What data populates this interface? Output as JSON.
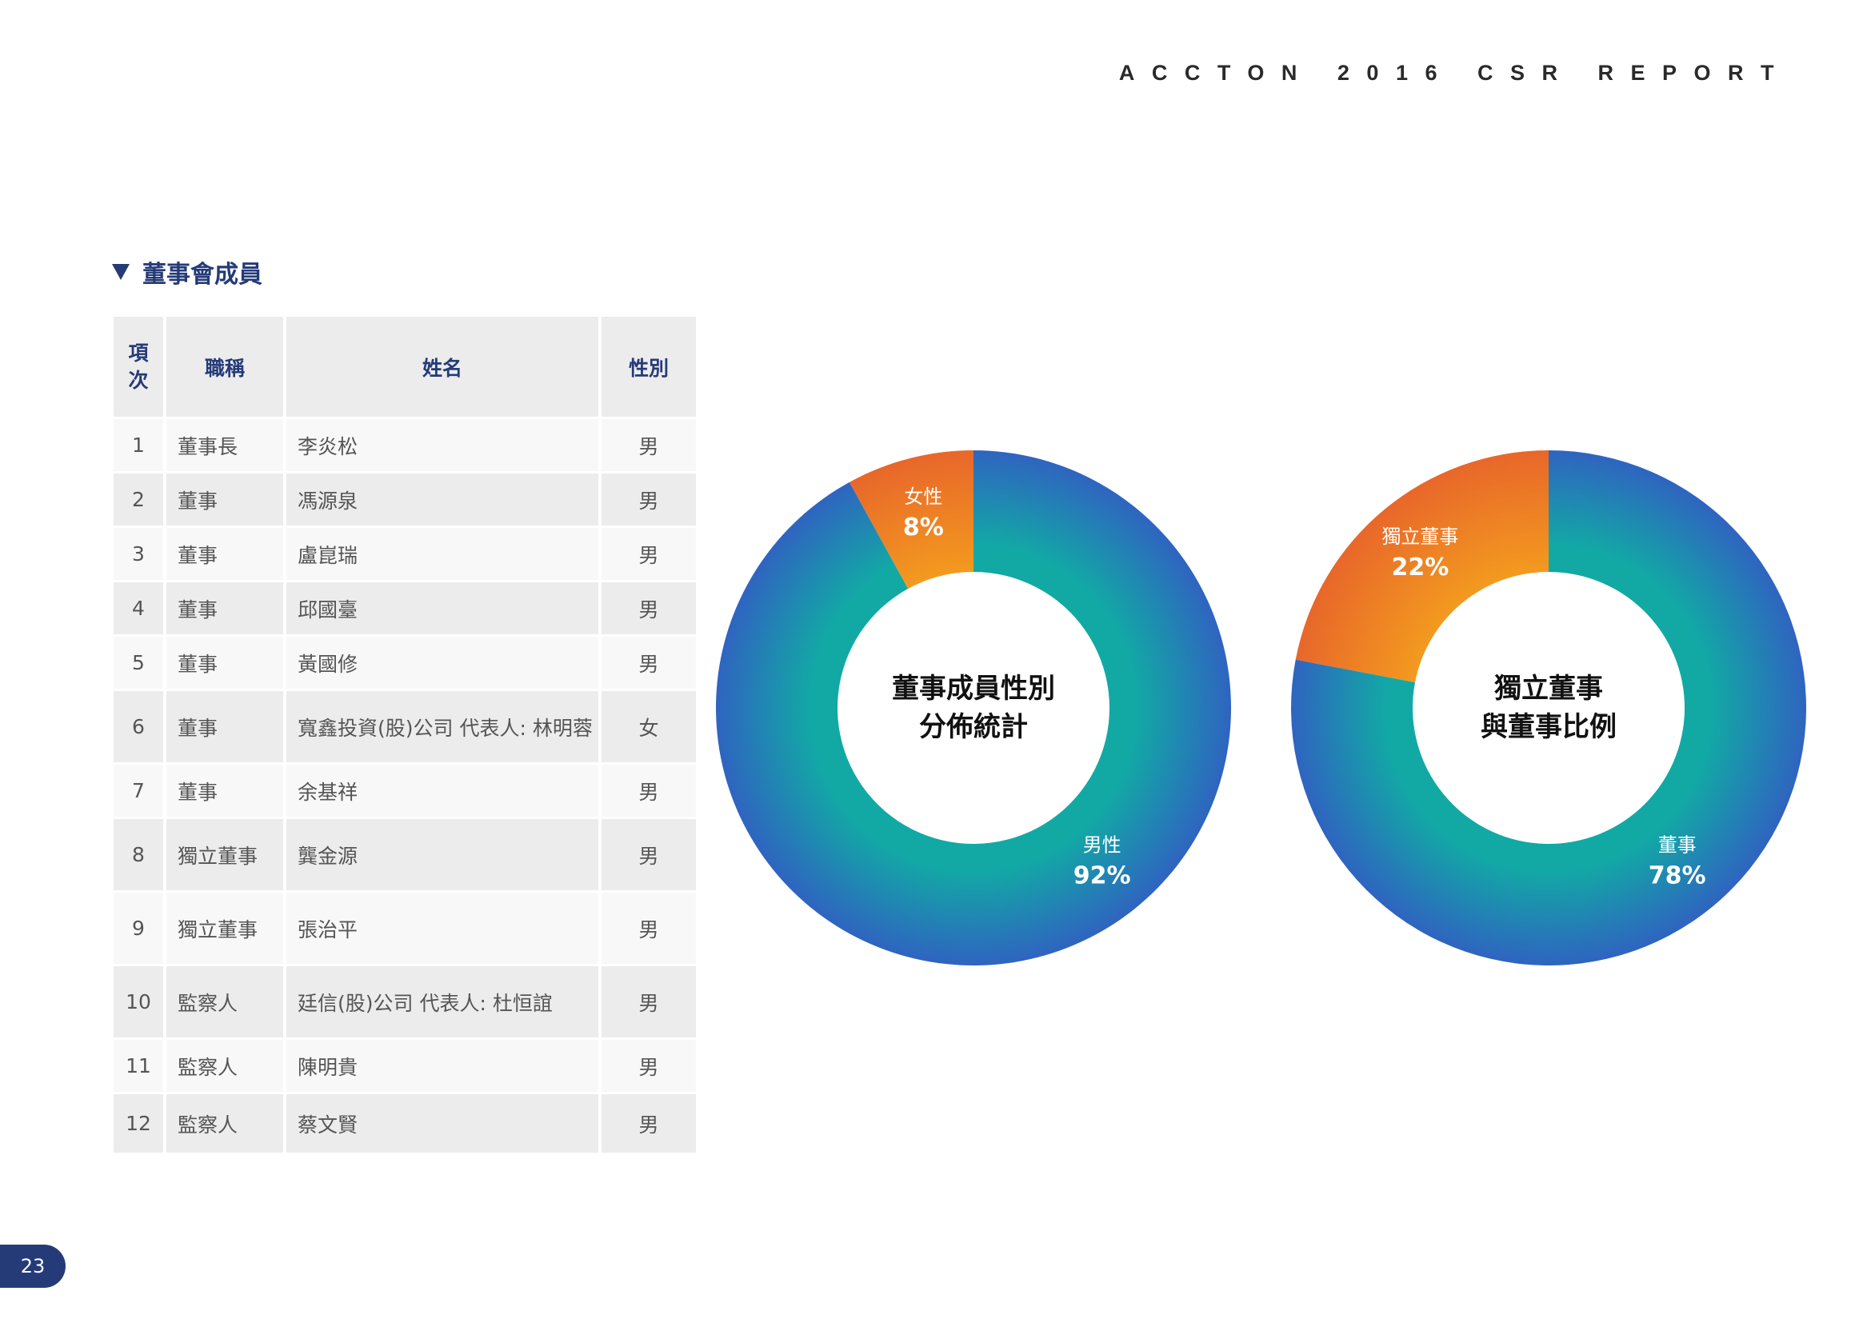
{
  "header": {
    "title": "ACCTON 2016 CSR REPORT"
  },
  "section": {
    "title": "董事會成員"
  },
  "table": {
    "headers": {
      "index": [
        "項",
        "次"
      ],
      "title": "職稱",
      "name": "姓名",
      "gender": "性別"
    },
    "rows": [
      {
        "index": "1",
        "title": "董事長",
        "name": "李炎松",
        "gender": "男"
      },
      {
        "index": "2",
        "title": "董事",
        "name": "馮源泉",
        "gender": "男"
      },
      {
        "index": "3",
        "title": "董事",
        "name": "盧崑瑞",
        "gender": "男"
      },
      {
        "index": "4",
        "title": "董事",
        "name": "邱國臺",
        "gender": "男"
      },
      {
        "index": "5",
        "title": "董事",
        "name": "黃國修",
        "gender": "男"
      },
      {
        "index": "6",
        "title": "董事",
        "name": "寬鑫投資(股)公司 代表人: 林明蓉",
        "gender": "女"
      },
      {
        "index": "7",
        "title": "董事",
        "name": "余基祥",
        "gender": "男"
      },
      {
        "index": "8",
        "title": "獨立董事",
        "name": "龔金源",
        "gender": "男"
      },
      {
        "index": "9",
        "title": "獨立董事",
        "name": "張治平",
        "gender": "男"
      },
      {
        "index": "10",
        "title": "監察人",
        "name": "廷信(股)公司 代表人: 杜恒誼",
        "gender": "男"
      },
      {
        "index": "11",
        "title": "監察人",
        "name": "陳明貴",
        "gender": "男"
      },
      {
        "index": "12",
        "title": "監察人",
        "name": "蔡文賢",
        "gender": "男"
      }
    ]
  },
  "chart_data": [
    {
      "type": "pie",
      "title": "董事成員性別分佈統計",
      "center_lines": [
        "董事成員性別",
        "分佈統計"
      ],
      "slices": [
        {
          "label": "女性",
          "display": "8%",
          "value": 8,
          "color": "#f39a1f"
        },
        {
          "label": "男性",
          "display": "92%",
          "value": 92,
          "color": "#12a9a5"
        }
      ]
    },
    {
      "type": "pie",
      "title": "獨立董事與董事比例",
      "center_lines": [
        "獨立董事",
        "與董事比例"
      ],
      "slices": [
        {
          "label": "獨立董事",
          "display": "22%",
          "value": 22,
          "color": "#f39a1f"
        },
        {
          "label": "董事",
          "display": "78%",
          "value": 78,
          "color": "#12a9a5"
        }
      ]
    }
  ],
  "colors": {
    "navy": "#253b78",
    "ring_outer": "#2f64c0",
    "teal": "#12a9a5",
    "orange": "#f39a1f",
    "orange_outer": "#e8672a"
  },
  "page": {
    "number": "23"
  }
}
